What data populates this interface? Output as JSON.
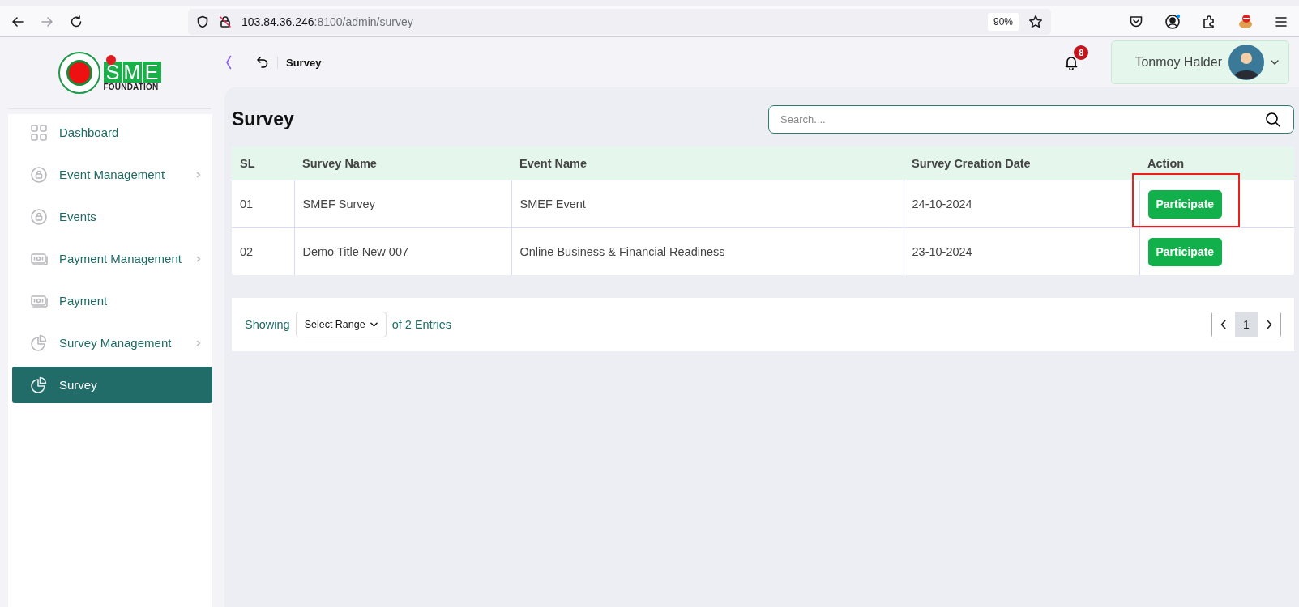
{
  "browser": {
    "url_host": "103.84.36.246",
    "url_rest": ":8100/admin/survey",
    "zoom": "90%"
  },
  "logo": {
    "letters": [
      "S",
      "M",
      "E"
    ],
    "subtitle": "FOUNDATION"
  },
  "sidebar": {
    "items": [
      {
        "label": "Dashboard",
        "kind": "grid",
        "expandable": false,
        "selected": false
      },
      {
        "label": "Event Management",
        "kind": "lock",
        "expandable": true,
        "selected": false
      },
      {
        "label": "Events",
        "kind": "lock",
        "expandable": false,
        "selected": false
      },
      {
        "label": "Payment Management",
        "kind": "cash",
        "expandable": true,
        "selected": false
      },
      {
        "label": "Payment",
        "kind": "cash",
        "expandable": false,
        "selected": false
      },
      {
        "label": "Survey Management",
        "kind": "pie",
        "expandable": true,
        "selected": false
      },
      {
        "label": "Survey",
        "kind": "pie",
        "expandable": false,
        "selected": true
      }
    ]
  },
  "header": {
    "breadcrumb": "Survey",
    "notification_count": "8",
    "user_name": "Tonmoy Halder"
  },
  "page": {
    "title": "Survey",
    "search": {
      "placeholder": "Search...."
    }
  },
  "table": {
    "columns": [
      "SL",
      "Survey Name",
      "Event Name",
      "Survey Creation Date",
      "Action"
    ],
    "rows": [
      {
        "sl": "01",
        "survey_name": "SMEF Survey",
        "event_name": "SMEF Event",
        "date": "24-10-2024",
        "action": "Participate",
        "highlighted": true
      },
      {
        "sl": "02",
        "survey_name": "Demo Title New 007",
        "event_name": "Online Business & Financial Readiness",
        "date": "23-10-2024",
        "action": "Participate",
        "highlighted": false
      }
    ]
  },
  "pagination": {
    "showing": "Showing",
    "range_select": "Select Range",
    "entries": "of 2 Entries",
    "pages": [
      {
        "label": "1",
        "selected": true
      }
    ]
  }
}
